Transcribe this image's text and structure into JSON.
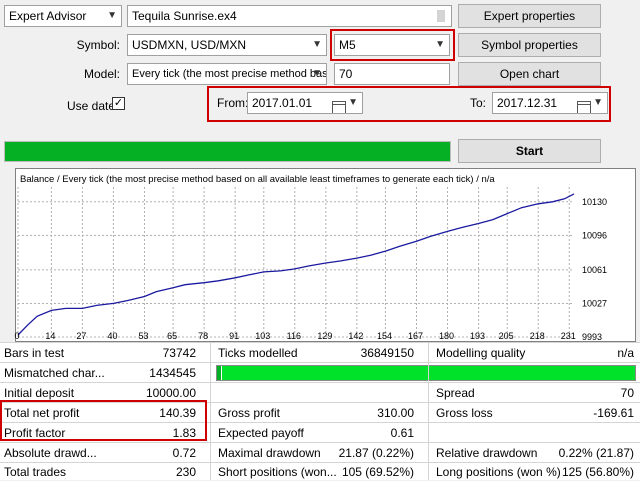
{
  "top": {
    "mode_select": "Expert Advisor",
    "ea_file": "Tequila Sunrise.ex4",
    "expert_properties": "Expert properties",
    "symbol_label": "Symbol:",
    "symbol_value": "USDMXN, USD/MXN",
    "period_value": "M5",
    "symbol_properties": "Symbol properties",
    "model_label": "Model:",
    "model_value": "Every tick (the most precise method bas",
    "spread_value": "70",
    "open_chart": "Open chart",
    "use_date_label": "Use date",
    "use_date_check": "✓",
    "from_label": "From:",
    "from_value": "2017.01.01",
    "to_label": "To:",
    "to_value": "2017.12.31",
    "start_button": "Start",
    "progress": 1.0
  },
  "chart_data": {
    "type": "line",
    "title": "Balance / Every tick (the most precise method based on all available least timeframes to generate each tick) / n/a",
    "x_ticks": [
      0,
      14,
      27,
      40,
      53,
      65,
      78,
      91,
      103,
      116,
      129,
      142,
      154,
      167,
      180,
      193,
      205,
      218,
      231
    ],
    "y_ticks": [
      10130,
      10096,
      10061,
      10027,
      9993
    ],
    "xlim": [
      0,
      233
    ],
    "ylim": [
      9993,
      10145
    ],
    "x": [
      0,
      4,
      8,
      14,
      20,
      27,
      33,
      40,
      46,
      53,
      58,
      65,
      70,
      78,
      84,
      91,
      97,
      103,
      110,
      116,
      122,
      129,
      135,
      142,
      148,
      154,
      160,
      167,
      173,
      180,
      186,
      193,
      199,
      205,
      211,
      218,
      224,
      229,
      233
    ],
    "y": [
      9995,
      10005,
      10014,
      10020,
      10022,
      10022,
      10025,
      10027,
      10030,
      10034,
      10039,
      10043,
      10046,
      10048,
      10050,
      10053,
      10056,
      10059,
      10060,
      10062,
      10065,
      10068,
      10070,
      10073,
      10076,
      10080,
      10085,
      10090,
      10095,
      10100,
      10104,
      10108,
      10112,
      10118,
      10124,
      10128,
      10130,
      10133,
      10138
    ]
  },
  "stats": {
    "bars_label": "Bars in test",
    "bars_value": "73742",
    "ticks_label": "Ticks modelled",
    "ticks_value": "36849150",
    "quality_label": "Modelling quality",
    "quality_value": "n/a",
    "mismatch_label": "Mismatched char...",
    "mismatch_value": "1434545",
    "deposit_label": "Initial deposit",
    "deposit_value": "10000.00",
    "spread_label": "Spread",
    "spread_value": "70",
    "net_label": "Total net profit",
    "net_value": "140.39",
    "gross_profit_label": "Gross profit",
    "gross_profit_value": "310.00",
    "gross_loss_label": "Gross loss",
    "gross_loss_value": "-169.61",
    "pf_label": "Profit factor",
    "pf_value": "1.83",
    "payoff_label": "Expected payoff",
    "payoff_value": "0.61",
    "abs_dd_label": "Absolute drawd...",
    "abs_dd_value": "0.72",
    "max_dd_label": "Maximal drawdown",
    "max_dd_value": "21.87 (0.22%)",
    "rel_dd_label": "Relative drawdown",
    "rel_dd_value": "0.22% (21.87)",
    "trades_label": "Total trades",
    "trades_value": "230",
    "short_label": "Short positions (won...",
    "short_value": "105 (69.52%)",
    "long_label": "Long positions (won %)",
    "long_value": "125 (56.80%)"
  }
}
